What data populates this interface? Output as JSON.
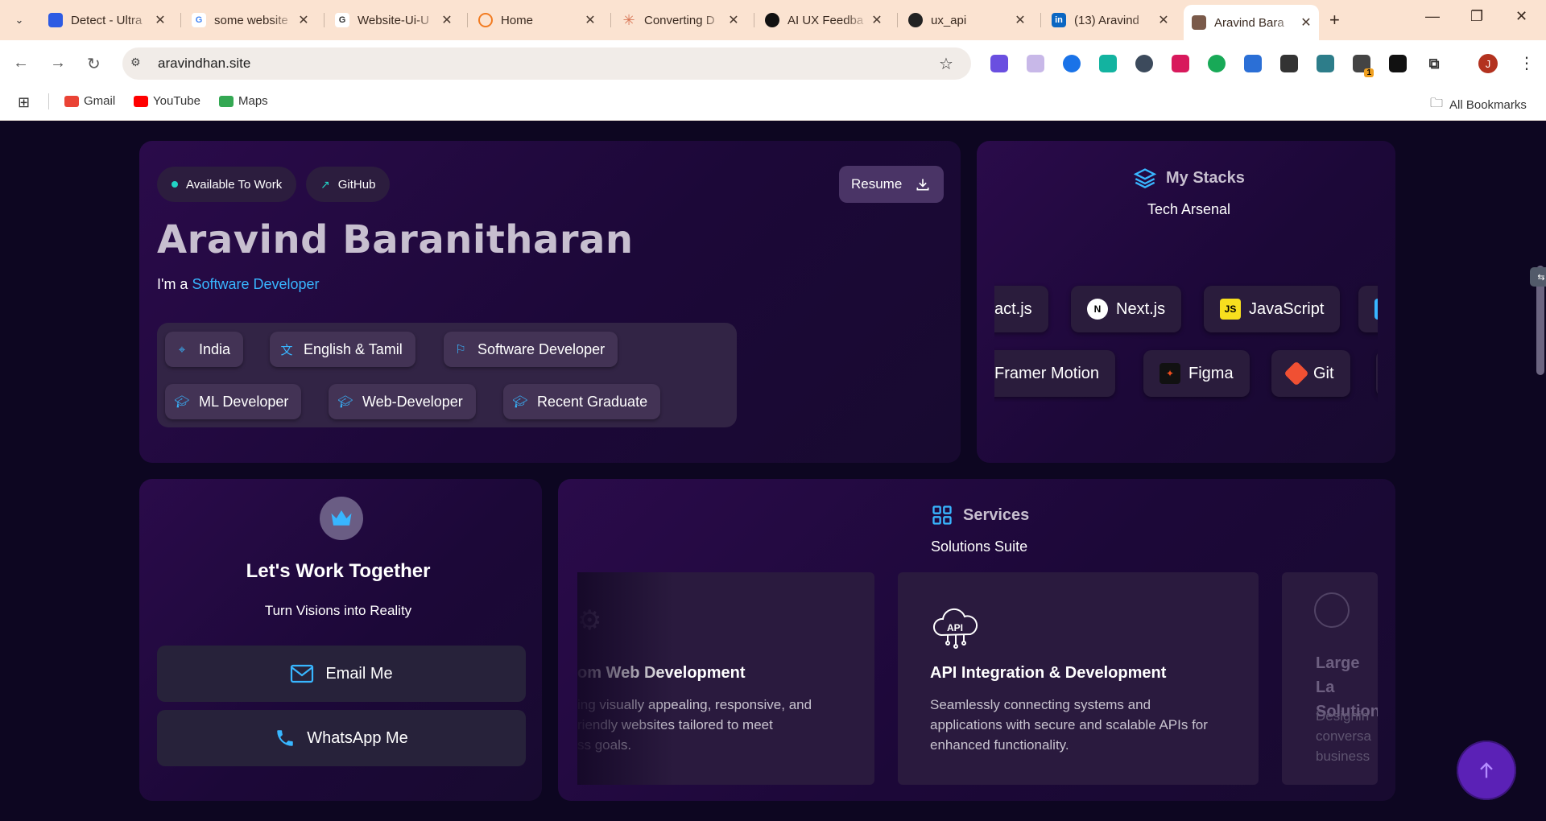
{
  "browser": {
    "tabs": [
      {
        "title": "Detect - Ultra",
        "favicon_color": "#2d5be3",
        "glyph": ""
      },
      {
        "title": "some website",
        "favicon_color": "#ffffff",
        "glyph": "G"
      },
      {
        "title": "Website-Ui-U",
        "favicon_color": "#ffffff",
        "glyph": "G"
      },
      {
        "title": "Home",
        "favicon_color": "#f27c22",
        "glyph": ""
      },
      {
        "title": "Converting D",
        "favicon_color": "#d97757",
        "glyph": "✳"
      },
      {
        "title": "AI UX Feedba",
        "favicon_color": "#111111",
        "glyph": ""
      },
      {
        "title": "ux_api",
        "favicon_color": "#222222",
        "glyph": ""
      },
      {
        "title": "(13) Aravind",
        "favicon_color": "#0a66c2",
        "glyph": "in"
      },
      {
        "title": "Aravind Bara",
        "favicon_color": "#7a5a4a",
        "glyph": ""
      }
    ],
    "url": "aravindhan.site",
    "profile_initial": "J",
    "bookmarks": [
      {
        "label": "Gmail",
        "color": "#ea4335"
      },
      {
        "label": "YouTube",
        "color": "#ff0000"
      },
      {
        "label": "Maps",
        "color": "#34a853"
      }
    ],
    "all_bookmarks_label": "All Bookmarks",
    "extension_badge": "1"
  },
  "hero": {
    "available_label": "Available To Work",
    "github_label": "GitHub",
    "resume_label": "Resume",
    "name": "Aravind Baranitharan",
    "intro_prefix": "I'm a",
    "role": "Software Developer",
    "tags": [
      {
        "label": "India",
        "icon": "map-pin-icon"
      },
      {
        "label": "English & Tamil",
        "icon": "translate-icon"
      },
      {
        "label": "Software Developer",
        "icon": "flag-icon"
      },
      {
        "label": "ML Developer",
        "icon": "graduation-cap-icon"
      },
      {
        "label": "Web-Developer",
        "icon": "graduation-cap-icon"
      },
      {
        "label": "Recent Graduate",
        "icon": "graduation-cap-icon"
      }
    ]
  },
  "stacks": {
    "title": "My Stacks",
    "subtitle": "Tech Arsenal",
    "row1": [
      {
        "label": "act.js",
        "icon": ""
      },
      {
        "label": "Next.js",
        "icon": "nextjs-icon"
      },
      {
        "label": "JavaScript",
        "icon": "javascript-icon"
      }
    ],
    "row2": [
      {
        "label": "Framer Motion",
        "icon": ""
      },
      {
        "label": "Figma",
        "icon": "figma-icon"
      },
      {
        "label": "Git",
        "icon": "git-icon"
      }
    ],
    "icon_text": {
      "next": "N",
      "js": "JS"
    }
  },
  "contact": {
    "title": "Let's Work Together",
    "subtitle": "Turn Visions into Reality",
    "email_label": "Email Me",
    "whatsapp_label": "WhatsApp Me"
  },
  "services": {
    "title": "Services",
    "subtitle": "Solutions Suite",
    "items": [
      {
        "title": "om Web Development",
        "desc": "ing visually appealing, responsive, and\nriendly websites tailored to meet\nss goals."
      },
      {
        "title": "API Integration & Development",
        "desc": "Seamlessly connecting systems and\napplications with secure and scalable APIs for\nenhanced functionality.",
        "icon_text": "API"
      },
      {
        "title": "Large La\nSolution",
        "desc": "Designin\nconversa\nbusiness"
      }
    ]
  },
  "colors": {
    "accent": "#38b6ff",
    "page_bg": "#0d0621",
    "card_bg": "#1f0a3c",
    "scroll_top": "#5b21b6"
  }
}
